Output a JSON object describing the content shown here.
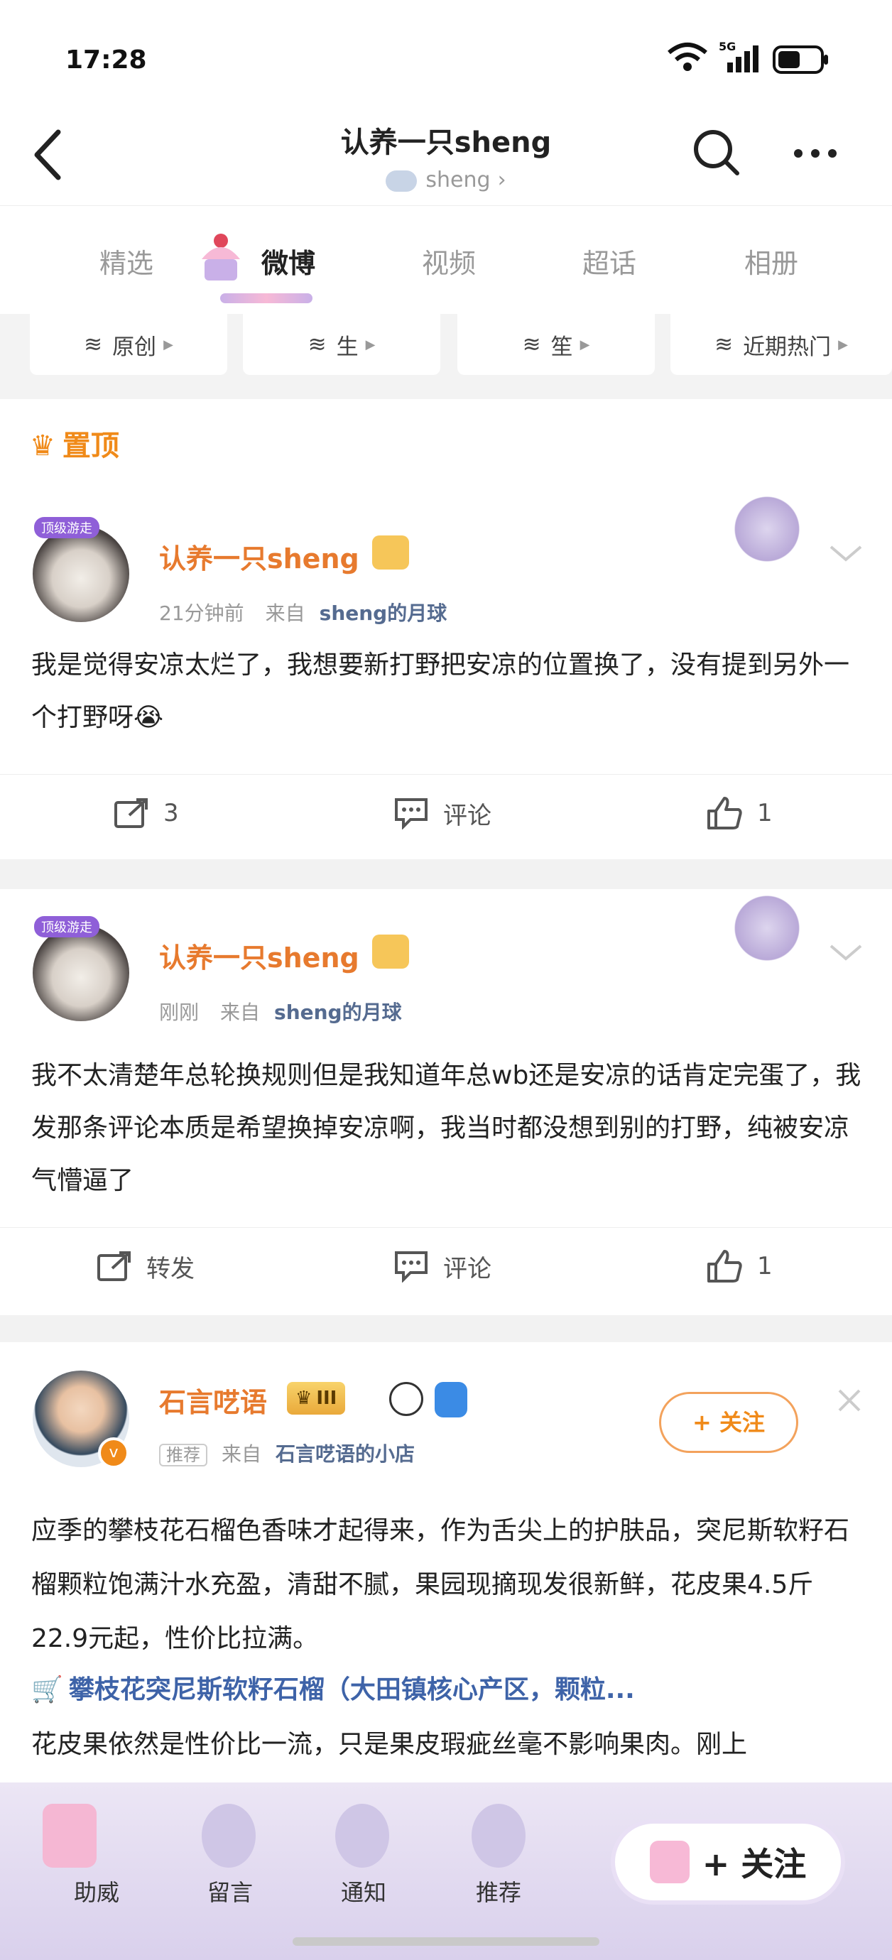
{
  "status_bar": {
    "time": "17:28",
    "network": "5G"
  },
  "header": {
    "title": "认养一只sheng",
    "subtitle": "sheng"
  },
  "tabs": [
    {
      "label": "精选",
      "active": false
    },
    {
      "label": "微博",
      "active": true
    },
    {
      "label": "视频",
      "active": false
    },
    {
      "label": "超话",
      "active": false
    },
    {
      "label": "相册",
      "active": false
    }
  ],
  "filters": [
    "原创",
    "生",
    "笙",
    "近期热门"
  ],
  "pinned_label": "置顶",
  "posts": [
    {
      "author": "认养一只sheng",
      "badge": "顶级游走",
      "time": "21分钟前",
      "from_prefix": "来自",
      "source": "sheng的月球",
      "text": "我是觉得安凉太烂了，我想要新打野把安凉的位置换了，没有提到另外一个打野呀😭",
      "repost": "3",
      "comment": "评论",
      "like": "1"
    },
    {
      "author": "认养一只sheng",
      "badge": "顶级游走",
      "time": "刚刚",
      "from_prefix": "来自",
      "source": "sheng的月球",
      "text": "我不太清楚年总轮换规则但是我知道年总wb还是安凉的话肯定完蛋了，我发那条评论本质是希望换掉安凉啊，我当时都没想到别的打野，纯被安凉气懵逼了",
      "repost": "转发",
      "comment": "评论",
      "like": "1"
    },
    {
      "author": "石言呓语",
      "level": "III",
      "tag": "推荐",
      "from_prefix": "来自",
      "source": "石言呓语的小店",
      "follow": "+ 关注",
      "text": "应季的攀枝花石榴色香味才起得来，作为舌尖上的护肤品，突尼斯软籽石榴颗粒饱满汁水充盈，清甜不腻，果园现摘现发很新鲜，花皮果4.5斤22.9元起，性价比拉满。",
      "link": "攀枝花突尼斯软籽石榴（大田镇核心产区，颗粒...",
      "text2": "花皮果依然是性价比一流，只是果皮瑕疵丝毫不影响果肉。刚上"
    }
  ],
  "bottom_bar": {
    "items": [
      "助威",
      "留言",
      "通知",
      "推荐"
    ],
    "follow": "+ 关注"
  }
}
